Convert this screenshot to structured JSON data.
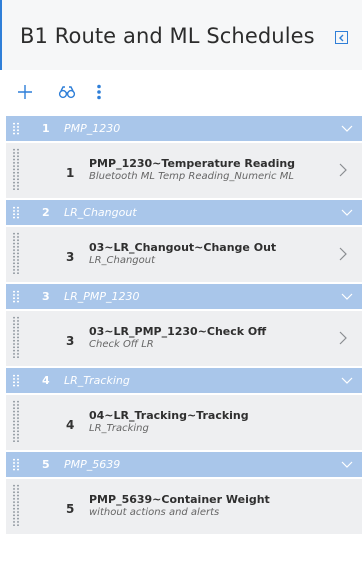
{
  "header": {
    "title": "B1 Route and ML Schedules"
  },
  "icons": {
    "collapse": "collapse-panel-icon",
    "add": "plus-icon",
    "search": "binoculars-icon",
    "more": "kebab-menu-icon",
    "expand": "chevron-down-icon",
    "open": "chevron-right-icon",
    "drag": "drag-handle-icon"
  },
  "colors": {
    "accent": "#2f7fd8",
    "group_header_bg": "#a9c6ea",
    "item_bg": "#eeeff1"
  },
  "groups": [
    {
      "index": "1",
      "name": "PMP_1230",
      "items": [
        {
          "index": "1",
          "title": "PMP_1230~Temperature Reading",
          "subtitle": "Bluetooth ML Temp Reading_Numeric ML",
          "has_chevron": true
        }
      ]
    },
    {
      "index": "2",
      "name": "LR_Changout",
      "items": [
        {
          "index": "3",
          "title": "03~LR_Changout~Change Out",
          "subtitle": "LR_Changout",
          "has_chevron": true
        }
      ]
    },
    {
      "index": "3",
      "name": "LR_PMP_1230",
      "items": [
        {
          "index": "3",
          "title": "03~LR_PMP_1230~Check Off",
          "subtitle": "Check Off LR",
          "has_chevron": true
        }
      ]
    },
    {
      "index": "4",
      "name": "LR_Tracking",
      "items": [
        {
          "index": "4",
          "title": "04~LR_Tracking~Tracking",
          "subtitle": "LR_Tracking",
          "has_chevron": false
        }
      ]
    },
    {
      "index": "5",
      "name": "PMP_5639",
      "items": [
        {
          "index": "5",
          "title": "PMP_5639~Container Weight",
          "subtitle": "without actions and alerts",
          "has_chevron": false
        }
      ]
    }
  ]
}
